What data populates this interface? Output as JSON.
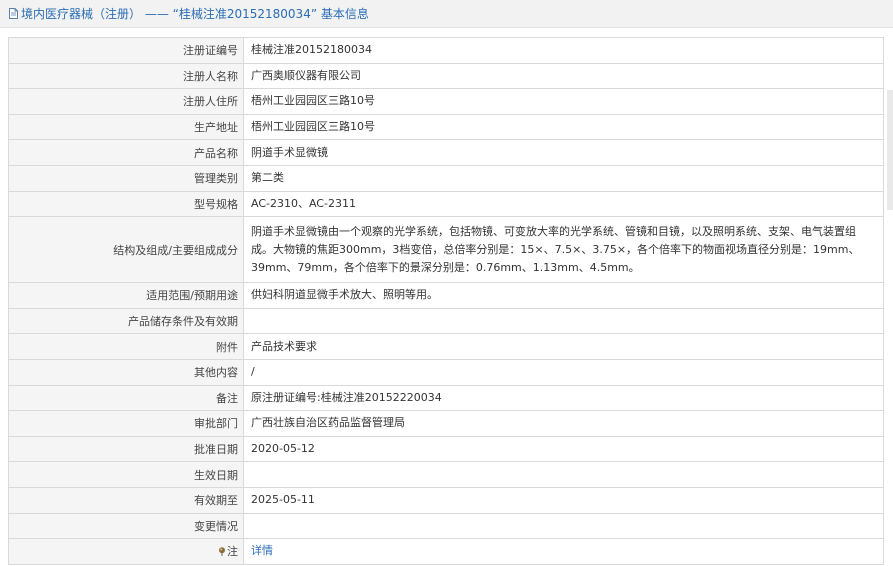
{
  "header": {
    "icon": "document-icon",
    "title": "境内医疗器械（注册） —— “桂械注准20152180034” 基本信息"
  },
  "rows": [
    {
      "label": "注册证编号",
      "value": "桂械注准20152180034"
    },
    {
      "label": "注册人名称",
      "value": "广西奥顺仪器有限公司"
    },
    {
      "label": "注册人住所",
      "value": "梧州工业园园区三路10号"
    },
    {
      "label": "生产地址",
      "value": "梧州工业园园区三路10号"
    },
    {
      "label": "产品名称",
      "value": "阴道手术显微镜"
    },
    {
      "label": "管理类别",
      "value": "第二类"
    },
    {
      "label": "型号规格",
      "value": "AC-2310、AC-2311"
    },
    {
      "label": "结构及组成/主要组成成分",
      "value": "阴道手术显微镜由一个观察的光学系统，包括物镜、可变放大率的光学系统、管镜和目镜，以及照明系统、支架、电气装置组成。大物镜的焦距300mm，3档变倍，总倍率分别是：15×、7.5×、3.75×，各个倍率下的物面视场直径分别是：19mm、39mm、79mm，各个倍率下的景深分别是：0.76mm、1.13mm、4.5mm。"
    },
    {
      "label": "适用范围/预期用途",
      "value": "供妇科阴道显微手术放大、照明等用。"
    },
    {
      "label": "产品储存条件及有效期",
      "value": ""
    },
    {
      "label": "附件",
      "value": "产品技术要求"
    },
    {
      "label": "其他内容",
      "value": "/"
    },
    {
      "label": "备注",
      "value": "原注册证编号:桂械注准20152220034"
    },
    {
      "label": "审批部门",
      "value": "广西壮族自治区药品监督管理局"
    },
    {
      "label": "批准日期",
      "value": "2020-05-12"
    },
    {
      "label": "生效日期",
      "value": ""
    },
    {
      "label": "有效期至",
      "value": "2025-05-11"
    },
    {
      "label": "变更情况",
      "value": ""
    }
  ],
  "note": {
    "icon": "pin-icon",
    "label": "注",
    "link_text": "详情"
  }
}
